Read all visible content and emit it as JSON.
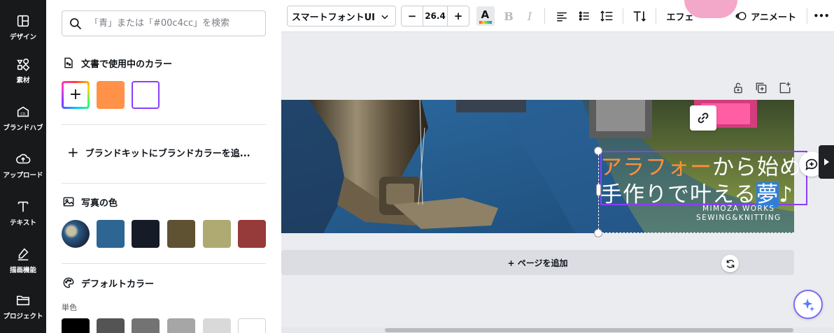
{
  "sidebar": {
    "items": [
      {
        "label": "デザイン",
        "icon": "design-icon"
      },
      {
        "label": "素材",
        "icon": "elements-icon"
      },
      {
        "label": "ブランドハブ",
        "icon": "brand-hub-icon"
      },
      {
        "label": "アップロード",
        "icon": "upload-icon"
      },
      {
        "label": "テキスト",
        "icon": "text-icon"
      },
      {
        "label": "描画機能",
        "icon": "draw-icon"
      },
      {
        "label": "プロジェクト",
        "icon": "folder-icon"
      }
    ]
  },
  "color_panel": {
    "search_placeholder": "「青」または「#00c4cc」を検索",
    "document_colors_title": "文書で使用中のカラー",
    "document_colors": [
      "#ff9248",
      "#ffffff"
    ],
    "add_brand_label": "ブランドキットにブランドカラーを追...",
    "photo_colors_title": "写真の色",
    "photo_colors": [
      "#2d6593",
      "#151c27",
      "#5e5232",
      "#aeaa72",
      "#963a3a"
    ],
    "default_colors_title": "デフォルトカラー",
    "solid_label": "単色",
    "default_colors": [
      "#000000",
      "#545454",
      "#737373",
      "#a6a6a6",
      "#d9d9d9",
      "#ffffff"
    ]
  },
  "toolbar": {
    "font_name": "スマートフォントUI",
    "font_size": "26.4",
    "minus": "−",
    "plus": "+",
    "effect_label": "エフェ",
    "animate_label": "アニメート",
    "more": "•••"
  },
  "canvas": {
    "headline_orange": "アラフォー",
    "headline_rest": "から始める",
    "line2_a": "手作りで叶える",
    "line2_selected": "夢",
    "line2_b": "♪",
    "sub1": "MIMOZA WORKS",
    "sub2": "SEWING&KNITTING",
    "add_page_label": "+ ページを追加"
  },
  "colors": {
    "accent_purple": "#8b3dff",
    "headline_orange": "#ff8f3b",
    "selection_blue": "#2f7fd6",
    "rail_bg": "#18191b"
  }
}
